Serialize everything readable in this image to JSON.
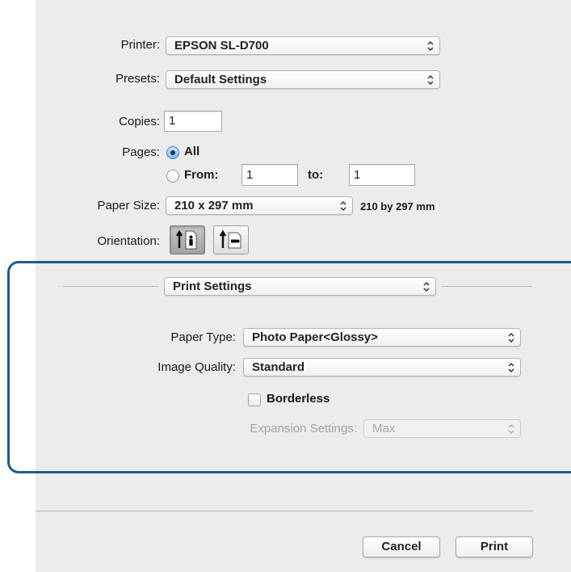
{
  "printer": {
    "label": "Printer:",
    "value": "EPSON SL-D700"
  },
  "presets": {
    "label": "Presets:",
    "value": "Default Settings"
  },
  "copies": {
    "label": "Copies:",
    "value": "1"
  },
  "pages": {
    "label": "Pages:",
    "all_label": "All",
    "from_label": "From:",
    "from_value": "1",
    "to_label": "to:",
    "to_value": "1",
    "selected": "All"
  },
  "paper_size": {
    "label": "Paper Size:",
    "value": "210 x 297 mm",
    "note": "210 by 297 mm"
  },
  "orientation": {
    "label": "Orientation:",
    "options": [
      "portrait",
      "landscape"
    ],
    "selected": "portrait"
  },
  "section_popup": {
    "value": "Print Settings"
  },
  "paper_type": {
    "label": "Paper Type:",
    "value": "Photo Paper<Glossy>"
  },
  "image_quality": {
    "label": "Image Quality:",
    "value": "Standard"
  },
  "borderless": {
    "label": "Borderless",
    "checked": false
  },
  "expansion": {
    "label": "Expansion Settings:",
    "value": "Max",
    "enabled": false
  },
  "buttons": {
    "cancel": "Cancel",
    "print": "Print"
  },
  "colors": {
    "highlight_border": "#1f5c8c",
    "panel_bg": "#ececec",
    "radio_selected": "#3d7fc8"
  }
}
